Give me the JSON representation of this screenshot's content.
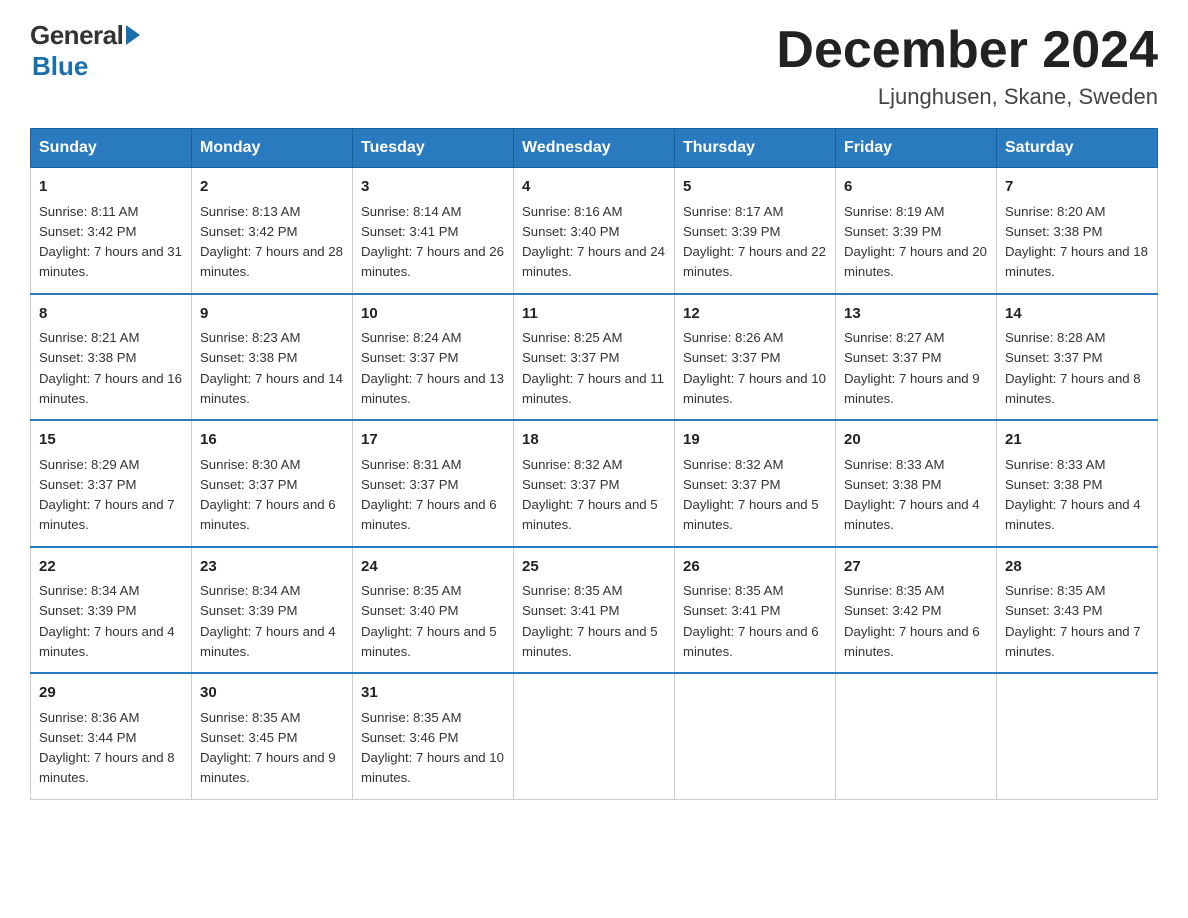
{
  "header": {
    "logo_general": "General",
    "logo_blue": "Blue",
    "logo_tagline": "Blue",
    "main_title": "December 2024",
    "subtitle": "Ljunghusen, Skane, Sweden"
  },
  "calendar": {
    "days_of_week": [
      "Sunday",
      "Monday",
      "Tuesday",
      "Wednesday",
      "Thursday",
      "Friday",
      "Saturday"
    ],
    "weeks": [
      [
        {
          "day": "1",
          "sunrise": "8:11 AM",
          "sunset": "3:42 PM",
          "daylight": "7 hours and 31 minutes."
        },
        {
          "day": "2",
          "sunrise": "8:13 AM",
          "sunset": "3:42 PM",
          "daylight": "7 hours and 28 minutes."
        },
        {
          "day": "3",
          "sunrise": "8:14 AM",
          "sunset": "3:41 PM",
          "daylight": "7 hours and 26 minutes."
        },
        {
          "day": "4",
          "sunrise": "8:16 AM",
          "sunset": "3:40 PM",
          "daylight": "7 hours and 24 minutes."
        },
        {
          "day": "5",
          "sunrise": "8:17 AM",
          "sunset": "3:39 PM",
          "daylight": "7 hours and 22 minutes."
        },
        {
          "day": "6",
          "sunrise": "8:19 AM",
          "sunset": "3:39 PM",
          "daylight": "7 hours and 20 minutes."
        },
        {
          "day": "7",
          "sunrise": "8:20 AM",
          "sunset": "3:38 PM",
          "daylight": "7 hours and 18 minutes."
        }
      ],
      [
        {
          "day": "8",
          "sunrise": "8:21 AM",
          "sunset": "3:38 PM",
          "daylight": "7 hours and 16 minutes."
        },
        {
          "day": "9",
          "sunrise": "8:23 AM",
          "sunset": "3:38 PM",
          "daylight": "7 hours and 14 minutes."
        },
        {
          "day": "10",
          "sunrise": "8:24 AM",
          "sunset": "3:37 PM",
          "daylight": "7 hours and 13 minutes."
        },
        {
          "day": "11",
          "sunrise": "8:25 AM",
          "sunset": "3:37 PM",
          "daylight": "7 hours and 11 minutes."
        },
        {
          "day": "12",
          "sunrise": "8:26 AM",
          "sunset": "3:37 PM",
          "daylight": "7 hours and 10 minutes."
        },
        {
          "day": "13",
          "sunrise": "8:27 AM",
          "sunset": "3:37 PM",
          "daylight": "7 hours and 9 minutes."
        },
        {
          "day": "14",
          "sunrise": "8:28 AM",
          "sunset": "3:37 PM",
          "daylight": "7 hours and 8 minutes."
        }
      ],
      [
        {
          "day": "15",
          "sunrise": "8:29 AM",
          "sunset": "3:37 PM",
          "daylight": "7 hours and 7 minutes."
        },
        {
          "day": "16",
          "sunrise": "8:30 AM",
          "sunset": "3:37 PM",
          "daylight": "7 hours and 6 minutes."
        },
        {
          "day": "17",
          "sunrise": "8:31 AM",
          "sunset": "3:37 PM",
          "daylight": "7 hours and 6 minutes."
        },
        {
          "day": "18",
          "sunrise": "8:32 AM",
          "sunset": "3:37 PM",
          "daylight": "7 hours and 5 minutes."
        },
        {
          "day": "19",
          "sunrise": "8:32 AM",
          "sunset": "3:37 PM",
          "daylight": "7 hours and 5 minutes."
        },
        {
          "day": "20",
          "sunrise": "8:33 AM",
          "sunset": "3:38 PM",
          "daylight": "7 hours and 4 minutes."
        },
        {
          "day": "21",
          "sunrise": "8:33 AM",
          "sunset": "3:38 PM",
          "daylight": "7 hours and 4 minutes."
        }
      ],
      [
        {
          "day": "22",
          "sunrise": "8:34 AM",
          "sunset": "3:39 PM",
          "daylight": "7 hours and 4 minutes."
        },
        {
          "day": "23",
          "sunrise": "8:34 AM",
          "sunset": "3:39 PM",
          "daylight": "7 hours and 4 minutes."
        },
        {
          "day": "24",
          "sunrise": "8:35 AM",
          "sunset": "3:40 PM",
          "daylight": "7 hours and 5 minutes."
        },
        {
          "day": "25",
          "sunrise": "8:35 AM",
          "sunset": "3:41 PM",
          "daylight": "7 hours and 5 minutes."
        },
        {
          "day": "26",
          "sunrise": "8:35 AM",
          "sunset": "3:41 PM",
          "daylight": "7 hours and 6 minutes."
        },
        {
          "day": "27",
          "sunrise": "8:35 AM",
          "sunset": "3:42 PM",
          "daylight": "7 hours and 6 minutes."
        },
        {
          "day": "28",
          "sunrise": "8:35 AM",
          "sunset": "3:43 PM",
          "daylight": "7 hours and 7 minutes."
        }
      ],
      [
        {
          "day": "29",
          "sunrise": "8:36 AM",
          "sunset": "3:44 PM",
          "daylight": "7 hours and 8 minutes."
        },
        {
          "day": "30",
          "sunrise": "8:35 AM",
          "sunset": "3:45 PM",
          "daylight": "7 hours and 9 minutes."
        },
        {
          "day": "31",
          "sunrise": "8:35 AM",
          "sunset": "3:46 PM",
          "daylight": "7 hours and 10 minutes."
        },
        null,
        null,
        null,
        null
      ]
    ]
  }
}
